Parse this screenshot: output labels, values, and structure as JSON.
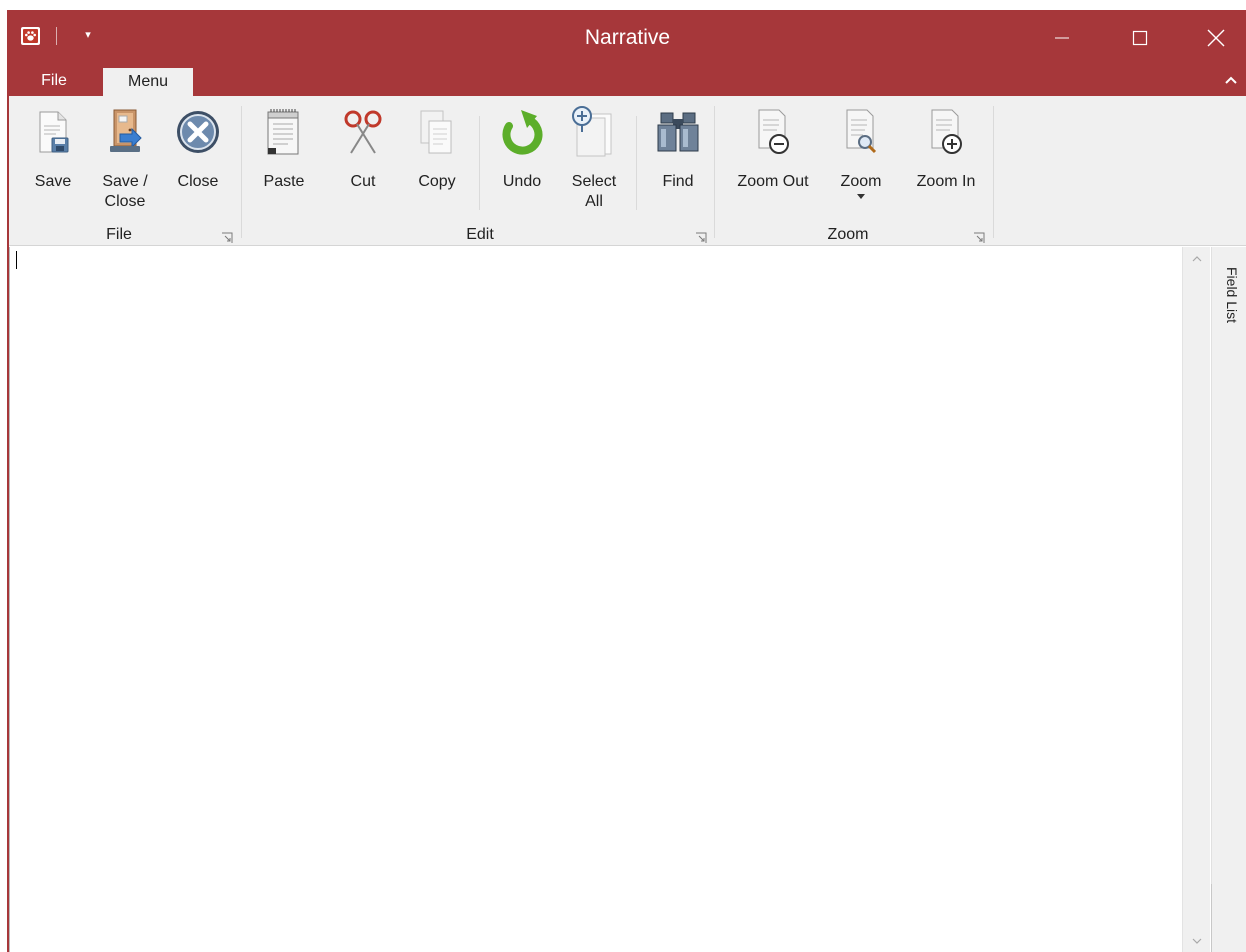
{
  "window": {
    "title": "Narrative",
    "accent_color": "#a6373a",
    "quick_access_dropdown_glyph": "▾",
    "controls": {
      "minimize_icon": "minimize-icon",
      "maximize_icon": "maximize-icon",
      "close_icon": "close-icon"
    }
  },
  "tabs": [
    {
      "label": "File",
      "active": false
    },
    {
      "label": "Menu",
      "active": true
    }
  ],
  "ribbon": {
    "collapse_icon": "chevron-up-icon",
    "groups": {
      "file": {
        "label": "File",
        "buttons": [
          {
            "label": "Save",
            "icon": "save-icon"
          },
          {
            "label": "Save /\nClose",
            "icon": "save-close-icon"
          },
          {
            "label": "Close",
            "icon": "close-circle-icon"
          }
        ]
      },
      "edit": {
        "label": "Edit",
        "buttons": [
          {
            "label": "Paste",
            "icon": "paste-icon"
          },
          {
            "label": "Cut",
            "icon": "scissors-icon"
          },
          {
            "label": "Copy",
            "icon": "copy-icon"
          },
          {
            "label": "Undo",
            "icon": "undo-icon"
          },
          {
            "label": "Select\nAll",
            "icon": "select-all-icon"
          },
          {
            "label": "Find",
            "icon": "binoculars-icon"
          }
        ]
      },
      "zoom": {
        "label": "Zoom",
        "buttons": [
          {
            "label": "Zoom Out",
            "icon": "zoom-out-icon"
          },
          {
            "label": "Zoom",
            "icon": "zoom-icon",
            "has_dropdown": true
          },
          {
            "label": "Zoom In",
            "icon": "zoom-in-icon"
          }
        ]
      }
    }
  },
  "document": {
    "text": ""
  },
  "side_panel": {
    "label": "Field List"
  }
}
